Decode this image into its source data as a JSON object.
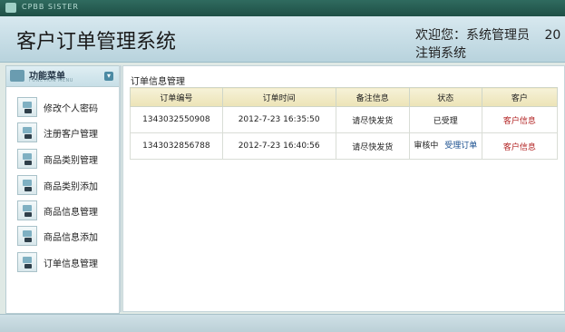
{
  "app": {
    "brand_small": "CPBB SISTER"
  },
  "header": {
    "title": "客户订单管理系统",
    "welcome": "欢迎您：系统管理员",
    "year_fragment": "20",
    "logout": "注销系统"
  },
  "sidebar": {
    "title": "功能菜单",
    "subtitle": "FUNCTION MENU",
    "items": [
      {
        "label": "修改个人密码"
      },
      {
        "label": "注册客户管理"
      },
      {
        "label": "商品类别管理"
      },
      {
        "label": "商品类别添加"
      },
      {
        "label": "商品信息管理"
      },
      {
        "label": "商品信息添加"
      },
      {
        "label": "订单信息管理"
      }
    ]
  },
  "main": {
    "panel_title": "订单信息管理",
    "columns": [
      "订单编号",
      "订单时间",
      "备注信息",
      "状态",
      "客户"
    ],
    "rows": [
      {
        "order_no": "1343032550908",
        "time": "2012-7-23 16:35:50",
        "note": "请尽快发货",
        "status": "已受理",
        "status_action": "",
        "customer": "客户信息"
      },
      {
        "order_no": "1343032856788",
        "time": "2012-7-23 16:40:56",
        "note": "请尽快发货",
        "status": "审核中",
        "status_action": "受理订单",
        "customer": "客户信息"
      }
    ]
  },
  "colors": {
    "header_bg": "#c7dde6",
    "table_head_bg": "#f0e8c2",
    "link_red": "#b22222",
    "link_blue": "#1a4f8f"
  }
}
